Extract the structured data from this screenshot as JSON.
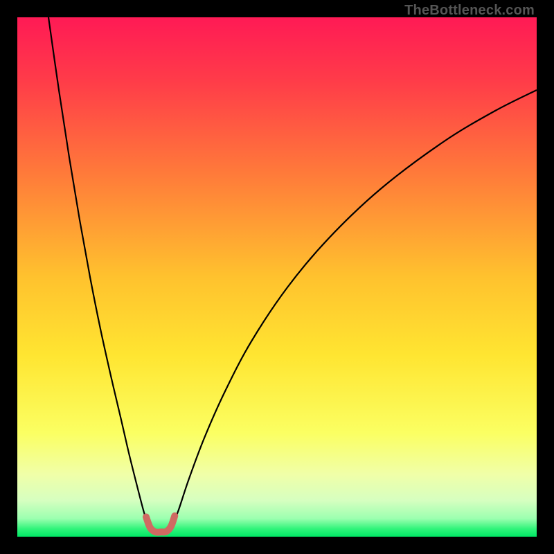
{
  "watermark": "TheBottleneck.com",
  "chart_data": {
    "type": "line",
    "title": "",
    "xlabel": "",
    "ylabel": "",
    "xlim": [
      0,
      100
    ],
    "ylim": [
      0,
      100
    ],
    "grid": false,
    "legend": false,
    "annotations": [],
    "background_gradient": {
      "stops": [
        {
          "pos": 0.0,
          "color": "#ff1a55"
        },
        {
          "pos": 0.12,
          "color": "#ff3b49"
        },
        {
          "pos": 0.3,
          "color": "#ff7a3a"
        },
        {
          "pos": 0.5,
          "color": "#ffc22e"
        },
        {
          "pos": 0.65,
          "color": "#ffe531"
        },
        {
          "pos": 0.8,
          "color": "#fbff62"
        },
        {
          "pos": 0.88,
          "color": "#f0ffa8"
        },
        {
          "pos": 0.93,
          "color": "#d6ffc0"
        },
        {
          "pos": 0.965,
          "color": "#9cffb0"
        },
        {
          "pos": 0.985,
          "color": "#30f47a"
        },
        {
          "pos": 1.0,
          "color": "#00e765"
        }
      ]
    },
    "series": [
      {
        "name": "left-arm",
        "color": "#000000",
        "stroke_width": 2.2,
        "x": [
          6.0,
          8.0,
          10.0,
          12.0,
          14.0,
          16.0,
          18.0,
          20.0,
          21.5,
          23.0,
          24.3,
          25.3
        ],
        "y": [
          100.0,
          86.0,
          73.0,
          61.0,
          50.0,
          40.0,
          31.0,
          22.5,
          16.0,
          10.0,
          5.0,
          1.8
        ]
      },
      {
        "name": "right-arm",
        "color": "#000000",
        "stroke_width": 2.2,
        "x": [
          29.7,
          31.0,
          33.0,
          36.0,
          40.0,
          45.0,
          52.0,
          60.0,
          70.0,
          82.0,
          92.0,
          100.0
        ],
        "y": [
          1.8,
          5.0,
          11.0,
          19.0,
          28.0,
          37.5,
          48.0,
          57.5,
          67.0,
          76.0,
          82.0,
          86.0
        ]
      },
      {
        "name": "valley-marker",
        "color": "#cf6a62",
        "stroke_width": 10,
        "linecap": "round",
        "x": [
          24.8,
          25.6,
          26.6,
          27.7,
          28.7,
          29.6,
          30.3
        ],
        "y": [
          3.8,
          1.7,
          0.9,
          0.9,
          1.0,
          2.0,
          4.0
        ]
      }
    ],
    "minimum": {
      "x": 27.5,
      "y": 0.9
    }
  }
}
